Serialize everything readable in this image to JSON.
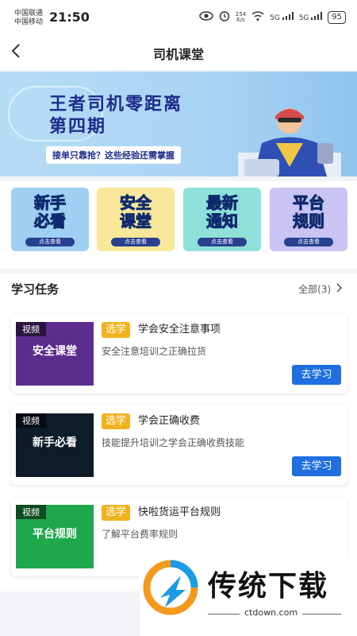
{
  "status_bar": {
    "carrier1": "中国联通",
    "carrier2": "中国移动",
    "time": "21:50",
    "net_speed_value": "254",
    "net_speed_unit": "K/s",
    "signal1": "5G",
    "signal2": "5G",
    "battery": "95"
  },
  "nav": {
    "title": "司机课堂",
    "back_icon": "chevron-left-icon"
  },
  "banner": {
    "title_line1": "王者司机零距离",
    "title_line2": "第四期",
    "subtitle": "接单只靠抢？这些经验还需掌握"
  },
  "categories": [
    {
      "line1": "新手",
      "line2": "必看",
      "button": "点击查看",
      "bg": "#9fd0f3"
    },
    {
      "line1": "安全",
      "line2": "课堂",
      "button": "点击查看",
      "bg": "#f9e79a"
    },
    {
      "line1": "最新",
      "line2": "通知",
      "button": "点击查看",
      "bg": "#8fe0d9"
    },
    {
      "line1": "平台",
      "line2": "规则",
      "button": "点击查看",
      "bg": "#c9c4f3"
    }
  ],
  "section": {
    "title": "学习任务",
    "all_label": "全部(3)",
    "chevron_icon": "chevron-right-icon"
  },
  "tasks": [
    {
      "tag": "视频",
      "thumb_text": "安全课堂",
      "thumb_bg": "#5b2d8e",
      "badge": "选学",
      "title": "学会安全注意事项",
      "desc": "安全注意培训之正确拉货",
      "button": "去学习"
    },
    {
      "tag": "视频",
      "thumb_text": "新手必看",
      "thumb_bg": "#0d1b2a",
      "badge": "选学",
      "title": "学会正确收费",
      "desc": "技能提升培训之学会正确收费技能",
      "button": "去学习"
    },
    {
      "tag": "视频",
      "thumb_text": "平台规则",
      "thumb_bg": "#1ea84b",
      "badge": "选学",
      "title": "快啦货运平台规则",
      "desc": "了解平台费率规则",
      "button": ""
    }
  ],
  "watermark": {
    "text": "传统下载",
    "url": "ctdown.com"
  },
  "colors": {
    "accent": "#1f6fe0",
    "badge": "#f2b21e",
    "banner_title": "#1d2c8a"
  }
}
